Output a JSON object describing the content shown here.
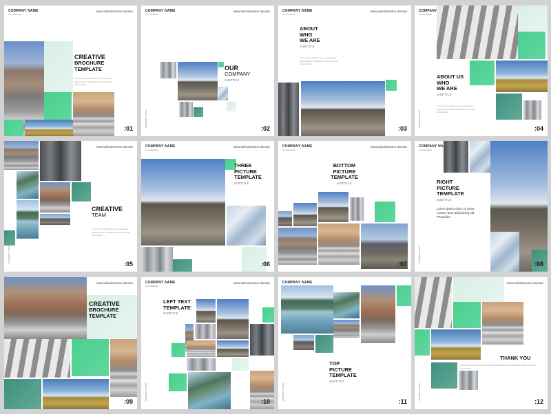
{
  "company": "COMPANY NAME",
  "company_tag": "●● ●●●●●●●",
  "website": "www.websitename.domain",
  "side_label": "designer name",
  "body_text": "Lorem ipsum dolor sit amet, consectetur adipiscing elit. Phasellus ut lacus sit amet odio facilisis.",
  "pages": [
    {
      "num": ":01",
      "l1": "CREATIVE",
      "l2": "BROCHURE",
      "l3": "TEMPLATE"
    },
    {
      "num": ":02",
      "l1": "OUR",
      "l2": "COMPANY",
      "sub": "SUBTITLE"
    },
    {
      "num": ":03",
      "l1": "ABOUT",
      "l2": "WHO",
      "l3": "WE ARE",
      "sub": "SUBTITLE"
    },
    {
      "num": ":04",
      "l1": "ABOUT US",
      "l2": "WHO",
      "l3": "WE ARE",
      "sub": "SUBTITLE"
    },
    {
      "num": ":05",
      "l1": "CREATIVE",
      "l2": "TEAM"
    },
    {
      "num": ":06",
      "l1": "THREE",
      "l2": "PICTURE",
      "l3": "TEMPLATE",
      "sub": "SUBTITLE"
    },
    {
      "num": ":07",
      "l1": "BOTTOM",
      "l2": "PICTURE",
      "l3": "TEMPLATE",
      "sub": "SUBTITLE"
    },
    {
      "num": ":08",
      "l1": "RIGHT",
      "l2": "PICTURE",
      "l3": "TEMPLATE",
      "sub": "SUBTITLE",
      "text": "Lorem ipsum dolor sit amet, consec tetur adi piscing elit. Phasellus"
    },
    {
      "num": ":09",
      "l1": "CREATIVE",
      "l2": "BROCHURE",
      "l3": "TEMPLATE"
    },
    {
      "num": ":10",
      "l1": "LEFT TEXT",
      "l2": "TEMPLATE",
      "sub": "SUBTITLE"
    },
    {
      "num": ":11",
      "l1": "TOP",
      "l2": "PICTURE",
      "l3": "TEMPLATE",
      "sub": "SUBTITLE"
    },
    {
      "num": ":12",
      "l1": "THANK YOU"
    }
  ]
}
